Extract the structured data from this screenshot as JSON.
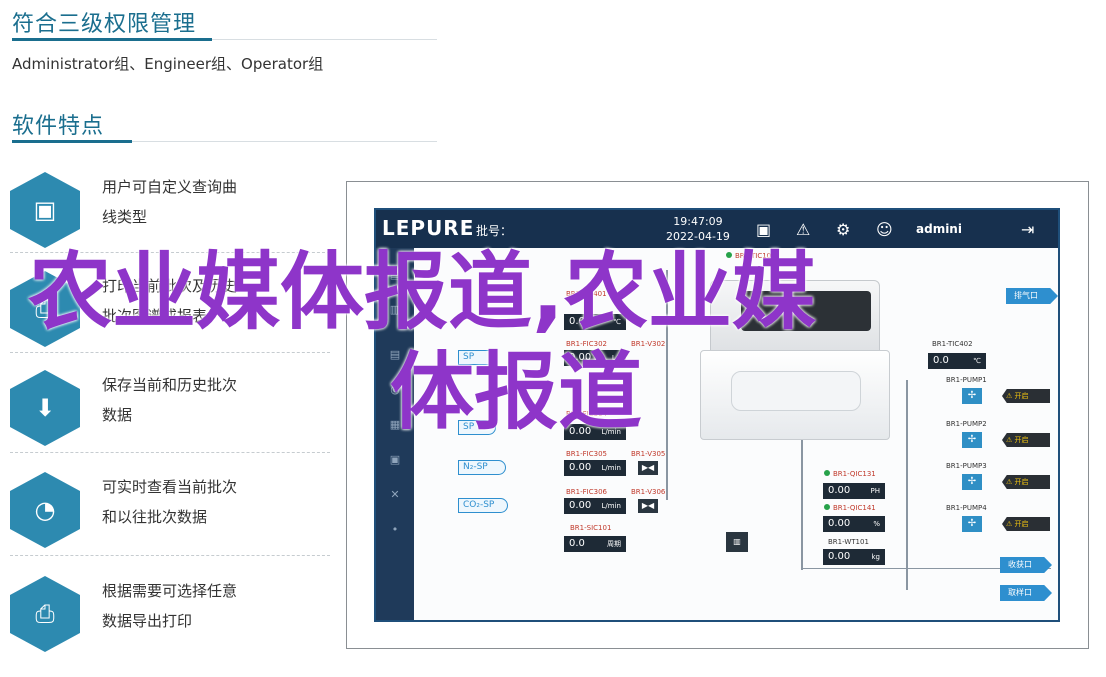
{
  "section1": {
    "title": "符合三级权限管理",
    "roles": "Administrator组、Engineer组、Operator组"
  },
  "section2": {
    "title": "软件特点"
  },
  "features": [
    {
      "icon": "chart-monitor-icon",
      "line1": "用户可自定义查询曲",
      "line2": "线类型"
    },
    {
      "icon": "print-history-icon",
      "line1": "打印当前批次及历史",
      "line2": "批次图谱或报表"
    },
    {
      "icon": "save-document-icon",
      "line1": "保存当前和历史批次",
      "line2": "数据"
    },
    {
      "icon": "realtime-chart-icon",
      "line1": "可实时查看当前批次",
      "line2": "和以往批次数据"
    },
    {
      "icon": "printer-icon",
      "line1": "根据需要可选择任意",
      "line2": "数据导出打印"
    }
  ],
  "app": {
    "logo": "LEPURE",
    "batch_label": "批号：",
    "time": "19:47:09",
    "date": "2022-04-19",
    "user": "admini",
    "tags": {
      "tic101": "BR1-TIC101",
      "tic401": "BR1-TIC401",
      "tic402": "BR1-TIC402",
      "fic302": "BR1-FIC302",
      "fic304": "BR1-FIC304",
      "fic305": "BR1-FIC305",
      "fic306": "BR1-FIC306",
      "v302": "BR1-V302",
      "v305": "BR1-V305",
      "v306": "BR1-V306",
      "sic101": "BR1-SIC101",
      "qic131": "BR1-QIC131",
      "qic141": "BR1-QIC141",
      "wt101": "BR1-WT101"
    },
    "values": {
      "temp_a": "0.0",
      "temp_unit": "℃",
      "flow_a": "0.00",
      "flow_unit_lr": "L/r",
      "flow_b": "0.00",
      "flow_unit": "L/min",
      "flow_c": "0.00",
      "speed": "0.0",
      "speed_unit": "周期",
      "ph": "0.00",
      "ph_unit": "PH",
      "pct": "0.00",
      "pct_unit": "%",
      "weight": "0.00",
      "weight_unit": "kg",
      "tic402": "0.0"
    },
    "sp_labels": {
      "sp_a": "SP",
      "sp_b": "SP",
      "n2": "N₂-SP",
      "co2": "CO₂-SP"
    },
    "pumps": [
      "BR1-PUMP1",
      "BR1-PUMP2",
      "BR1-PUMP3",
      "BR1-PUMP4"
    ],
    "warn_label": "开启",
    "ports": {
      "exhaust": "排气口",
      "harvest": "收获口",
      "sample": "取样口"
    }
  },
  "watermark": {
    "line1": "农业媒体报道,农业媒",
    "line2": "体报道"
  }
}
